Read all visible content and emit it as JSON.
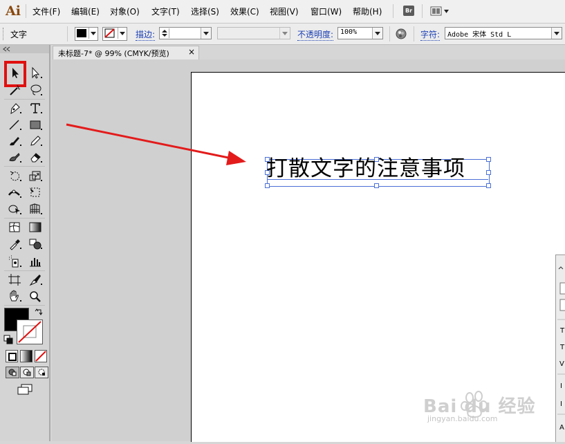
{
  "app": {
    "logo": "Ai"
  },
  "menu": [
    "文件(F)",
    "编辑(E)",
    "对象(O)",
    "文字(T)",
    "选择(S)",
    "效果(C)",
    "视图(V)",
    "窗口(W)",
    "帮助(H)"
  ],
  "menu_buttons": {
    "bridge": "Br"
  },
  "control_bar": {
    "context_label": "文字",
    "stroke_label": "描边:",
    "opacity_label": "不透明度:",
    "opacity_value": "100%",
    "character_label": "字符:",
    "font_value": "Adobe 宋体 Std L"
  },
  "document": {
    "tab_title": "未标题-7* @ 99% (CMYK/预览)",
    "close_glyph": "×"
  },
  "canvas": {
    "text_content": "打散文字的注意事项"
  },
  "tools": [
    "selection-tool",
    "direct-selection-tool",
    "magic-wand-tool",
    "lasso-tool",
    "pen-tool",
    "type-tool",
    "line-segment-tool",
    "rectangle-tool",
    "paintbrush-tool",
    "pencil-tool",
    "blob-brush-tool",
    "eraser-tool",
    "rotate-tool",
    "scale-tool",
    "width-tool",
    "free-transform-tool",
    "shape-builder-tool",
    "perspective-grid-tool",
    "mesh-tool",
    "gradient-tool",
    "eyedropper-tool",
    "blend-tool",
    "symbol-sprayer-tool",
    "column-graph-tool",
    "artboard-tool",
    "slice-tool",
    "hand-tool",
    "zoom-tool"
  ],
  "colors": {
    "highlight_red": "#e01010",
    "arrow_red": "#e31b1b",
    "selection_blue": "#4a6fd6",
    "logo_brown": "#8a4a0f"
  },
  "watermark": {
    "brand": "Bai du 经验",
    "url": "jingyan.baidu.com"
  }
}
